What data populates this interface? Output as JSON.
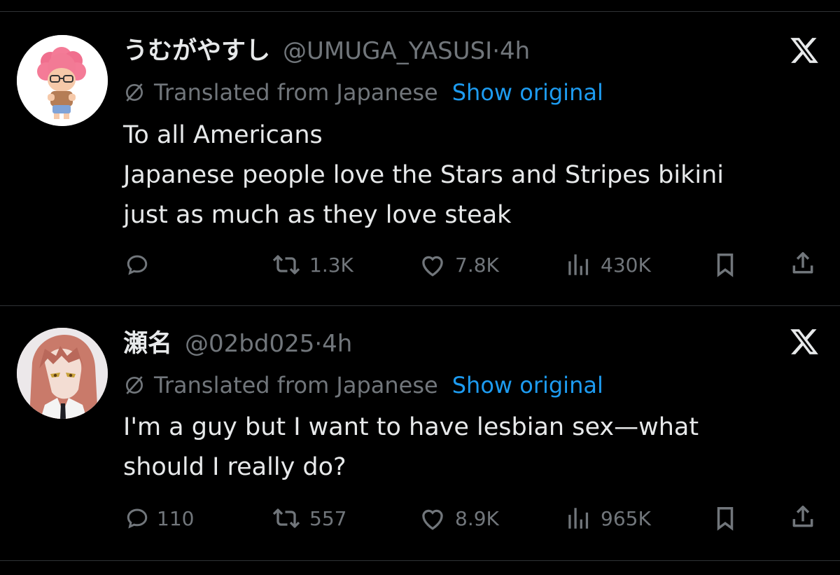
{
  "colors": {
    "background": "#000000",
    "text": "#e7e9ea",
    "muted": "#71767b",
    "link": "#1d9bf0",
    "divider": "#2f3336"
  },
  "tweets": [
    {
      "display_name": "うむがやすし",
      "handle": "@UMUGA_YASUSI",
      "separator": "·",
      "time": "4h",
      "platform_icon": "x-logo-icon",
      "translated_label": "Translated from Japanese",
      "show_original_label": "Show original",
      "body_lines": [
        "To all Americans",
        "Japanese people love the Stars and Stripes bikini",
        "just as much as they love steak"
      ],
      "actions": {
        "reply": "",
        "retweet": "1.3K",
        "like": "7.8K",
        "views": "430K"
      }
    },
    {
      "display_name": "瀬名",
      "handle": "@02bd025",
      "separator": "·",
      "time": "4h",
      "platform_icon": "x-logo-icon",
      "translated_label": "Translated from Japanese",
      "show_original_label": "Show original",
      "body_lines": [
        "I'm a guy but I want to have lesbian sex—what",
        "should I really do?"
      ],
      "actions": {
        "reply": "110",
        "retweet": "557",
        "like": "8.9K",
        "views": "965K"
      }
    }
  ]
}
